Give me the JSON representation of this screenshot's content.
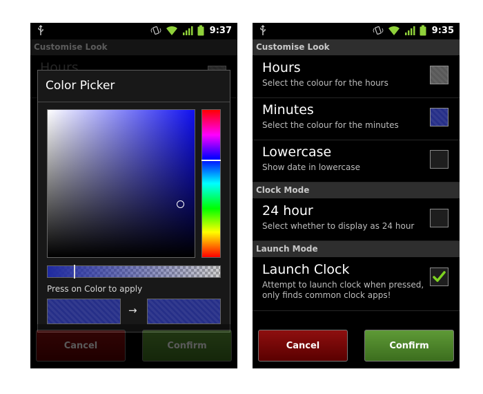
{
  "status": {
    "left_time": "9:37",
    "right_time": "9:35"
  },
  "settings": {
    "section_look": "Customise Look",
    "hours": {
      "title": "Hours",
      "subtitle": "Select the colour for the hours"
    },
    "minutes": {
      "title": "Minutes",
      "subtitle": "Select the colour for the minutes"
    },
    "lowercase": {
      "title": "Lowercase",
      "subtitle": "Show date in lowercase"
    },
    "section_clock_mode": "Clock Mode",
    "hour24": {
      "title": "24 hour",
      "subtitle": "Select whether to display as 24 hour"
    },
    "section_launch_mode": "Launch Mode",
    "launch": {
      "title": "Launch Clock",
      "subtitle": "Attempt to launch clock when pressed, only finds common clock apps!",
      "checked": true
    }
  },
  "buttons": {
    "cancel": "Cancel",
    "confirm": "Confirm"
  },
  "color_picker": {
    "title": "Color Picker",
    "instruction": "Press on Color to apply",
    "arrow": "→",
    "colors": {
      "selected": "#262f88",
      "hue": "#0000ff"
    }
  }
}
